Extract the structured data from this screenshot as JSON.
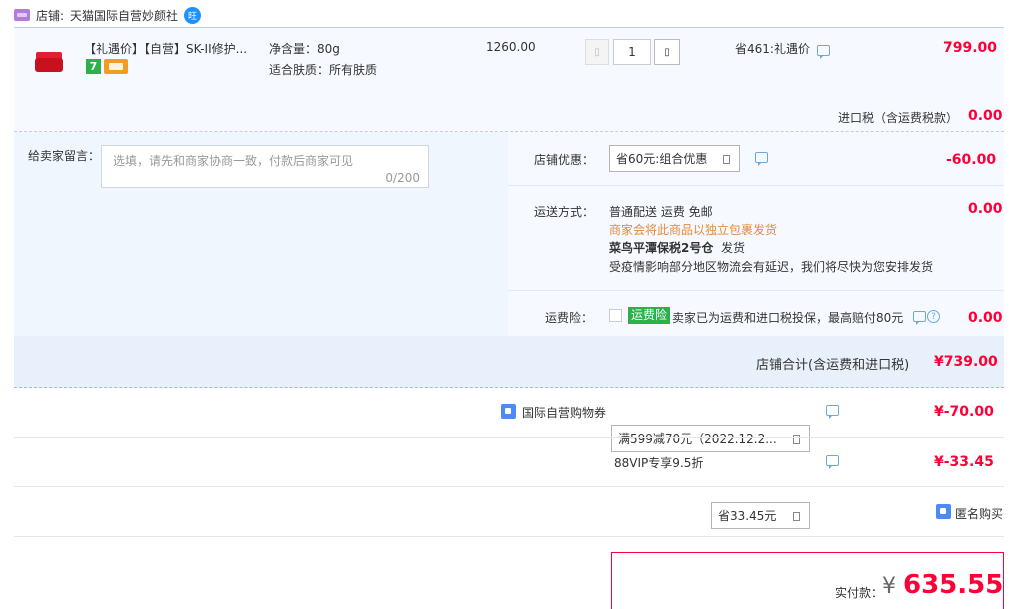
{
  "shop": {
    "label": "店铺:",
    "name": "天猫国际自营妙颜社",
    "icon": "tmall-shop-icon",
    "chat_icon": "wangwang-chat-icon",
    "chat_icon_text": "旺"
  },
  "product": {
    "title": "【礼遇价】【自营】SK-II修护...",
    "spec_1": "净含量：80g",
    "spec_2": "适合肤质：所有肤质",
    "unit_price": "1260.00",
    "quantity": "1",
    "promo": "省461:礼遇价",
    "subtotal": "799.00",
    "badge_7": "7",
    "import_tax_label": "进口税（含运费税款）",
    "import_tax_value": "0.00"
  },
  "message": {
    "label": "给卖家留言：",
    "placeholder": "选填，请先和商家协商一致，付款后商家可见",
    "counter": "0/200"
  },
  "shop_discount": {
    "label": "店铺优惠：",
    "selected": "省60元:组合优惠",
    "amount": "-60.00"
  },
  "shipping": {
    "label": "运送方式：",
    "line1": "普通配送 运费 免邮",
    "line2": "商家会将此商品以独立包裹发货",
    "line3_bold": "菜鸟平潭保税2号仓",
    "line3_rest": "发货",
    "line4": "受疫情影响部分地区物流会有延迟，我们将尽快为您安排发货",
    "fee": "0.00"
  },
  "insurance": {
    "label": "运费险：",
    "tag": "运费险",
    "text": "卖家已为运费和进口税投保，最高赔付80元",
    "help": "?",
    "fee": "0.00"
  },
  "shop_total": {
    "label": "店铺合计(含运费和进口税)",
    "value": "¥739.00"
  },
  "coupon": {
    "label": "国际自营购物券",
    "selected": "满599减70元（2022.12.2...",
    "amount": "¥-70.00"
  },
  "vip": {
    "label": "88VIP专享9.5折",
    "selected": "省33.45元",
    "amount": "¥-33.45"
  },
  "anonymous": {
    "label": "匿名购买"
  },
  "payment": {
    "label": "实付款：",
    "currency": "¥",
    "amount": "635.55"
  },
  "colors": {
    "accent_red": "#ff0036",
    "link_blue": "#4c8bf5",
    "insurance_green": "#2ab14a",
    "shipping_orange": "#e88a3a"
  }
}
